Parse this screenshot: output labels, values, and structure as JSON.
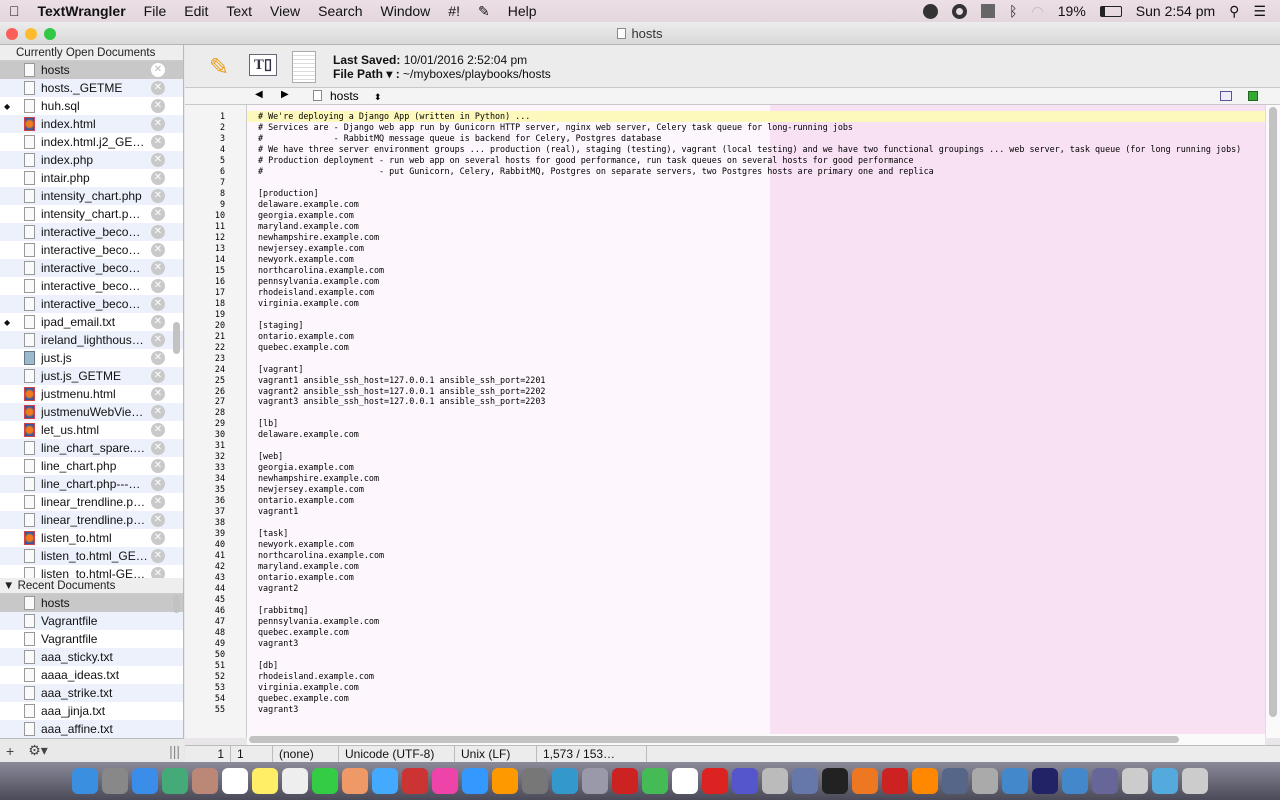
{
  "menubar": {
    "apple": "",
    "app": "TextWrangler",
    "items": [
      "File",
      "Edit",
      "Text",
      "View",
      "Search",
      "Window",
      "#!",
      "✎",
      "Help"
    ],
    "battery": "19%",
    "clock": "Sun 2:54 pm"
  },
  "window": {
    "title": "hosts"
  },
  "sidebar": {
    "open_header": "Currently Open Documents",
    "open_docs": [
      {
        "name": "hosts",
        "icon": "doc",
        "sel": true,
        "dirty": false
      },
      {
        "name": "hosts._GETME",
        "icon": "doc",
        "dirty": false
      },
      {
        "name": "huh.sql",
        "icon": "doc",
        "dirty": true
      },
      {
        "name": "index.html",
        "icon": "firefox",
        "dirty": false
      },
      {
        "name": "index.html.j2_GE…",
        "icon": "doc",
        "dirty": false
      },
      {
        "name": "index.php",
        "icon": "doc",
        "dirty": false
      },
      {
        "name": "intair.php",
        "icon": "doc",
        "dirty": false
      },
      {
        "name": "intensity_chart.php",
        "icon": "doc",
        "dirty": false
      },
      {
        "name": "intensity_chart.p…",
        "icon": "doc",
        "dirty": false
      },
      {
        "name": "interactive_beco…",
        "icon": "doc",
        "dirty": false
      },
      {
        "name": "interactive_beco…",
        "icon": "doc",
        "dirty": false
      },
      {
        "name": "interactive_beco…",
        "icon": "doc",
        "dirty": false
      },
      {
        "name": "interactive_beco…",
        "icon": "doc",
        "dirty": false
      },
      {
        "name": "interactive_beco…",
        "icon": "doc",
        "dirty": false
      },
      {
        "name": "ipad_email.txt",
        "icon": "doc",
        "dirty": true
      },
      {
        "name": "ireland_lighthous…",
        "icon": "doc",
        "dirty": false
      },
      {
        "name": "just.js",
        "icon": "js",
        "dirty": false
      },
      {
        "name": "just.js_GETME",
        "icon": "doc",
        "dirty": false
      },
      {
        "name": "justmenu.html",
        "icon": "firefox",
        "dirty": false
      },
      {
        "name": "justmenuWebVie…",
        "icon": "firefox",
        "dirty": false
      },
      {
        "name": "let_us.html",
        "icon": "firefox",
        "dirty": false
      },
      {
        "name": "line_chart_spare.…",
        "icon": "doc",
        "dirty": false
      },
      {
        "name": "line_chart.php",
        "icon": "doc",
        "dirty": false
      },
      {
        "name": "line_chart.php---…",
        "icon": "doc",
        "dirty": false
      },
      {
        "name": "linear_trendline.p…",
        "icon": "doc",
        "dirty": false
      },
      {
        "name": "linear_trendline.p…",
        "icon": "doc",
        "dirty": false
      },
      {
        "name": "listen_to.html",
        "icon": "firefox",
        "dirty": false
      },
      {
        "name": "listen_to.html_GE…",
        "icon": "doc",
        "dirty": false
      },
      {
        "name": "listen_to.html-GE…",
        "icon": "doc",
        "dirty": false
      }
    ],
    "recent_header": "Recent Documents",
    "recent_docs": [
      "hosts",
      "Vagrantfile",
      "Vagrantfile",
      "aaa_sticky.txt",
      "aaaa_ideas.txt",
      "aaa_strike.txt",
      "aaa_jinja.txt",
      "aaa_affine.txt"
    ]
  },
  "toolbar": {
    "last_saved_label": "Last Saved:",
    "last_saved": "10/01/2016 2:52:04 pm",
    "file_path_label": "File Path ▾ :",
    "file_path": "~/myboxes/playbooks/hosts"
  },
  "navbar": {
    "doc": "hosts"
  },
  "code": [
    "# We're deploying a Django App (written in Python) ...",
    "# Services are - Django web app run by Gunicorn HTTP server, nginx web server, Celery task queue for long-running jobs",
    "#              - RabbitMQ message queue is backend for Celery, Postgres database",
    "# We have three server environment groups ... production (real), staging (testing), vagrant (local testing) and we have two functional groupings ... web server, task queue (for long running jobs)",
    "# Production deployment - run web app on several hosts for good performance, run task queues on several hosts for good performance",
    "#                       - put Gunicorn, Celery, RabbitMQ, Postgres on separate servers, two Postgres hosts are primary one and replica",
    "",
    "[production]",
    "delaware.example.com",
    "georgia.example.com",
    "maryland.example.com",
    "newhampshire.example.com",
    "newjersey.example.com",
    "newyork.example.com",
    "northcarolina.example.com",
    "pennsylvania.example.com",
    "rhodeisland.example.com",
    "virginia.example.com",
    "",
    "[staging]",
    "ontario.example.com",
    "quebec.example.com",
    "",
    "[vagrant]",
    "vagrant1 ansible_ssh_host=127.0.0.1 ansible_ssh_port=2201",
    "vagrant2 ansible_ssh_host=127.0.0.1 ansible_ssh_port=2202",
    "vagrant3 ansible_ssh_host=127.0.0.1 ansible_ssh_port=2203",
    "",
    "[lb]",
    "delaware.example.com",
    "",
    "[web]",
    "georgia.example.com",
    "newhampshire.example.com",
    "newjersey.example.com",
    "ontario.example.com",
    "vagrant1",
    "",
    "[task]",
    "newyork.example.com",
    "northcarolina.example.com",
    "maryland.example.com",
    "ontario.example.com",
    "vagrant2",
    "",
    "[rabbitmq]",
    "pennsylvania.example.com",
    "quebec.example.com",
    "vagrant3",
    "",
    "[db]",
    "rhodeisland.example.com",
    "virginia.example.com",
    "quebec.example.com",
    "vagrant3"
  ],
  "status": {
    "line": "1",
    "col": "1",
    "language": "(none)",
    "encoding": "Unicode (UTF-8)",
    "line_endings": "Unix (LF)",
    "counts": "1,573 / 153…"
  },
  "colors": {
    "highlight": "#fdf8bc",
    "page_guide": "#f7e1f3"
  },
  "dock": [
    "finder",
    "launchpad",
    "safari",
    "preview",
    "notes",
    "calendar",
    "stickies",
    "textedit",
    "facetime",
    "photos",
    "messages",
    "photo-booth",
    "itunes",
    "app-store",
    "ibooks",
    "system-preferences",
    "xcode",
    "textwrangler",
    "filezilla",
    "chrome",
    "textfile",
    "opera",
    "imovie",
    "mail",
    "image-capture",
    "terminal",
    "firefox",
    "filezilla",
    "vlc",
    "network",
    "help",
    "virtualbox",
    "bbedit",
    "virtualbox",
    "php",
    "usb",
    "downloads",
    "trash"
  ]
}
